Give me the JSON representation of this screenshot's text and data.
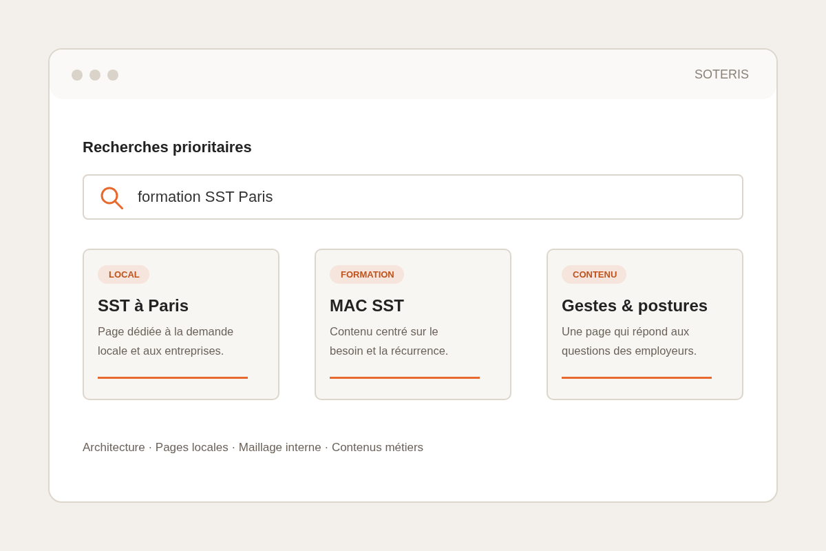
{
  "window": {
    "brand": "SOTERIS"
  },
  "heading": "Recherches prioritaires",
  "search": {
    "value": "formation SST Paris"
  },
  "cards": [
    {
      "tag": "LOCAL",
      "title": "SST à Paris",
      "description": "Page dédiée à la demande locale et aux entreprises."
    },
    {
      "tag": "FORMATION",
      "title": "MAC SST",
      "description": "Contenu centré sur le besoin et la récurrence."
    },
    {
      "tag": "CONTENU",
      "title": "Gestes & postures",
      "description": "Une page qui répond aux questions des employeurs."
    }
  ],
  "footer": "Architecture · Pages locales · Maillage interne · Contenus métiers"
}
